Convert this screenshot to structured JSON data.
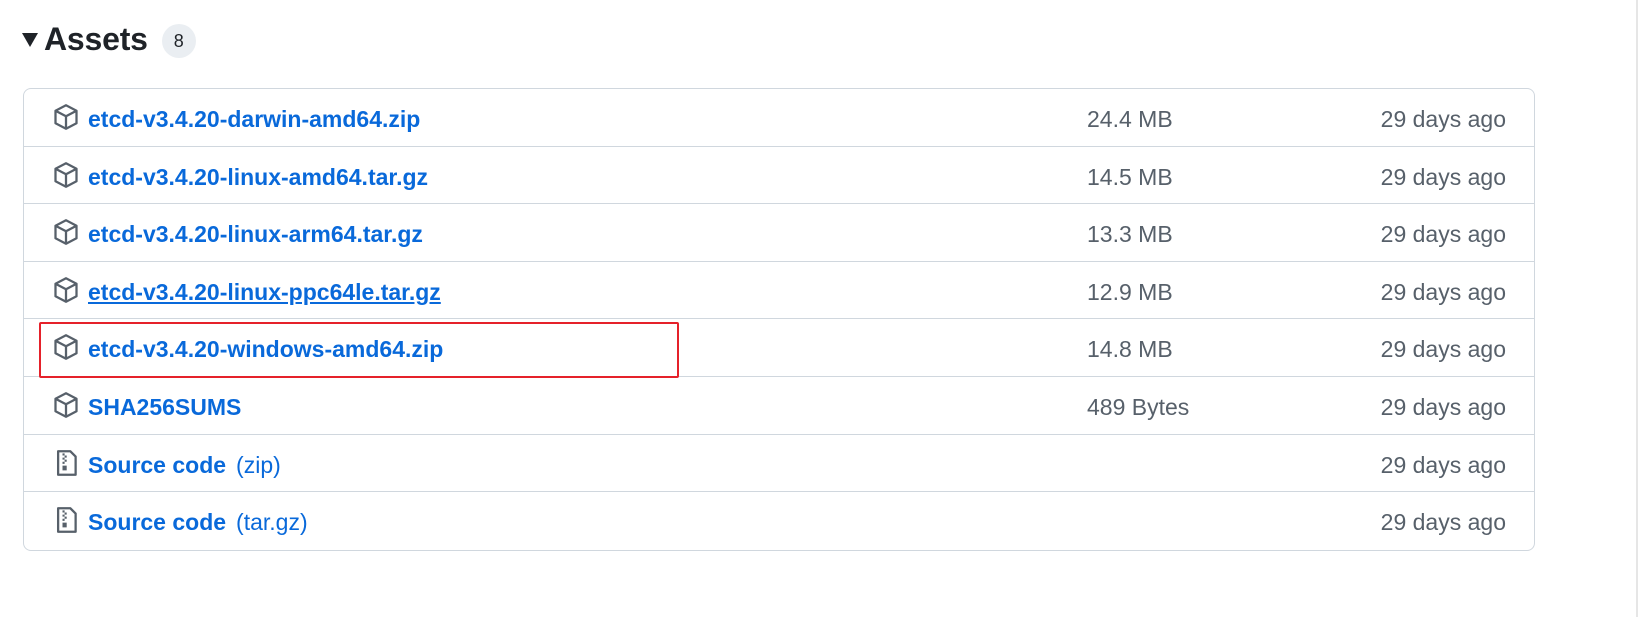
{
  "header": {
    "title": "Assets",
    "count": "8",
    "toggle_icon": "triangle-down-icon"
  },
  "assets": [
    {
      "name": "etcd-v3.4.20-darwin-amd64.zip",
      "ext": "",
      "size": "24.4 MB",
      "date": "29 days ago",
      "icon": "package-icon"
    },
    {
      "name": "etcd-v3.4.20-linux-amd64.tar.gz",
      "ext": "",
      "size": "14.5 MB",
      "date": "29 days ago",
      "icon": "package-icon"
    },
    {
      "name": "etcd-v3.4.20-linux-arm64.tar.gz",
      "ext": "",
      "size": "13.3 MB",
      "date": "29 days ago",
      "icon": "package-icon"
    },
    {
      "name": "etcd-v3.4.20-linux-ppc64le.tar.gz",
      "ext": "",
      "size": "12.9 MB",
      "date": "29 days ago",
      "icon": "package-icon"
    },
    {
      "name": "etcd-v3.4.20-windows-amd64.zip",
      "ext": "",
      "size": "14.8 MB",
      "date": "29 days ago",
      "icon": "package-icon"
    },
    {
      "name": "SHA256SUMS",
      "ext": "",
      "size": "489 Bytes",
      "date": "29 days ago",
      "icon": "package-icon"
    },
    {
      "name": "Source code",
      "ext": "(zip)",
      "size": "",
      "date": "29 days ago",
      "icon": "file-zip-icon"
    },
    {
      "name": "Source code",
      "ext": "(tar.gz)",
      "size": "",
      "date": "29 days ago",
      "icon": "file-zip-icon"
    }
  ],
  "colors": {
    "link": "#0969da",
    "muted": "#57606a",
    "border": "#d0d7de",
    "highlight": "#e5212a"
  }
}
